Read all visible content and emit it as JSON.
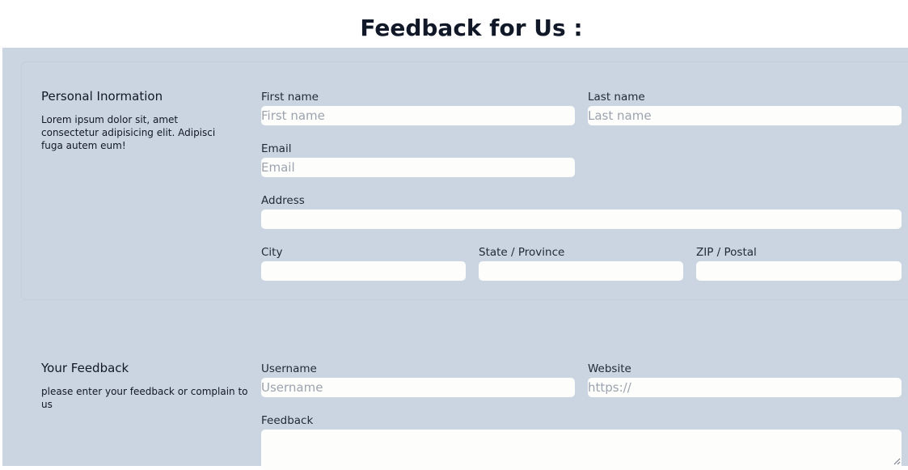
{
  "page": {
    "title": "Feedback for Us :"
  },
  "personal": {
    "heading": "Personal Inormation",
    "description": "Lorem ipsum dolor sit, amet consectetur adipisicing elit. Adipisci fuga autem eum!",
    "first_name": {
      "label": "First name",
      "placeholder": "First name",
      "value": ""
    },
    "last_name": {
      "label": "Last name",
      "placeholder": "Last name",
      "value": ""
    },
    "email": {
      "label": "Email",
      "placeholder": "Email",
      "value": ""
    },
    "address": {
      "label": "Address",
      "placeholder": "",
      "value": ""
    },
    "city": {
      "label": "City",
      "placeholder": "",
      "value": ""
    },
    "state": {
      "label": "State / Province",
      "placeholder": "",
      "value": ""
    },
    "zip": {
      "label": "ZIP / Postal",
      "placeholder": "",
      "value": ""
    }
  },
  "feedback": {
    "heading": "Your Feedback",
    "description": "please enter your feedback or complain to us",
    "username": {
      "label": "Username",
      "placeholder": "Username",
      "value": ""
    },
    "website": {
      "label": "Website",
      "placeholder": "https://",
      "value": ""
    },
    "feedback": {
      "label": "Feedback",
      "placeholder": "",
      "value": ""
    }
  },
  "colors": {
    "form_background": "#cbd5e1",
    "input_background": "#fdfefb",
    "placeholder": "#9ca3af",
    "text": "#1f2937"
  }
}
